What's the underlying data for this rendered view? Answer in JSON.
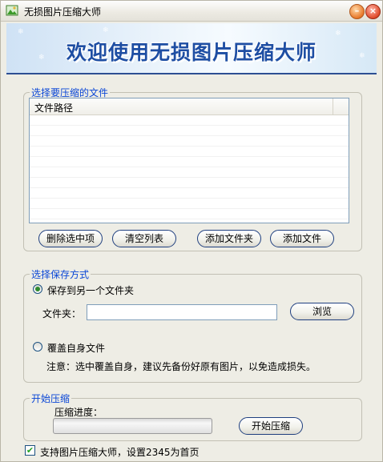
{
  "window": {
    "title": "无损图片压缩大师"
  },
  "banner": {
    "text": "欢迎使用无损图片压缩大师"
  },
  "files_group": {
    "legend": "选择要压缩的文件",
    "column_header": "文件路径",
    "buttons": {
      "remove_selected": "删除选中项",
      "clear_list": "清空列表",
      "add_folder": "添加文件夹",
      "add_file": "添加文件"
    }
  },
  "save_group": {
    "legend": "选择保存方式",
    "option_other_folder": "保存到另一个文件夹",
    "option_other_folder_selected": true,
    "folder_label": "文件夹：",
    "folder_value": "",
    "browse_button": "浏览",
    "option_overwrite": "覆盖自身文件",
    "option_overwrite_selected": false,
    "note": "注意：选中覆盖自身，建议先备份好原有图片，以免造成损失。"
  },
  "compress_group": {
    "legend": "开始压缩",
    "progress_label": "压缩进度：",
    "progress": 0,
    "start_button": "开始压缩"
  },
  "footer": {
    "support_checked": true,
    "support_label": "支持图片压缩大师，设置2345为首页"
  },
  "colors": {
    "legend": "#0a46d6",
    "banner_text": "#1e4ea3",
    "progress_fill": "#2fb62f",
    "radio_dot": "#2f8a2f"
  }
}
